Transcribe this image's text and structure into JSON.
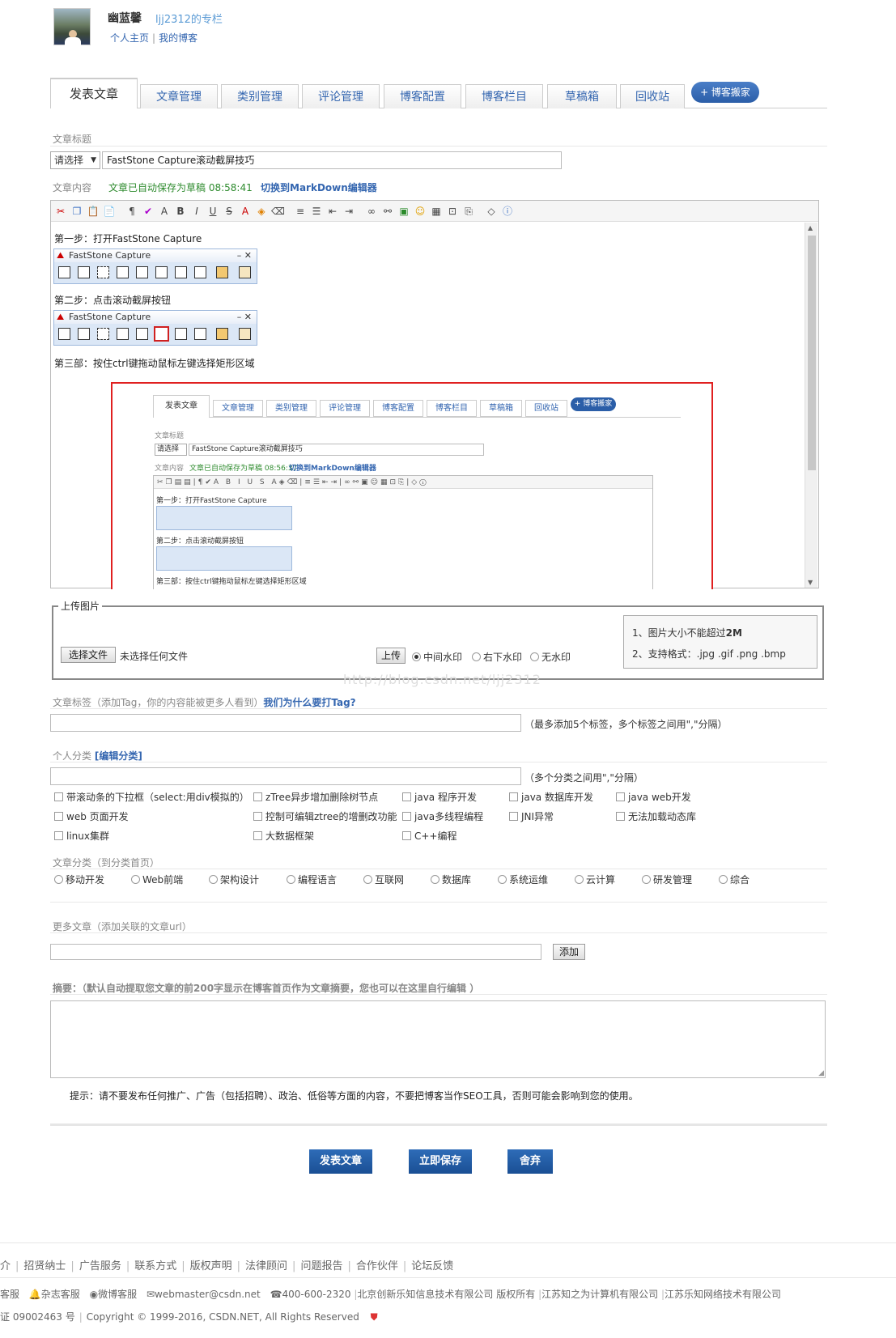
{
  "header": {
    "user_name": "幽蓝馨",
    "column_name": "ljj2312的专栏",
    "home_link": "个人主页",
    "sep": "|",
    "blog_link": "我的博客"
  },
  "tabs": [
    "发表文章",
    "文章管理",
    "类别管理",
    "评论管理",
    "博客配置",
    "博客栏目",
    "草稿箱",
    "回收站"
  ],
  "move_button": "+ 博客搬家",
  "form": {
    "title_label": "文章标题",
    "type_select": "请选择",
    "title_value": "FastStone Capture滚动截屏技巧",
    "content_label": "文章内容",
    "autosave_text": "文章已自动保存为草稿 08:58:41",
    "markdown_link": "切换到MarkDown编辑器"
  },
  "editor": {
    "step1": "第一步：打开FastStone Capture",
    "step2": "第二步：点击滚动截屏按钮",
    "step3": "第三部：按住ctrl键拖动鼠标左键选择矩形区域",
    "fs_title": "FastStone Capture",
    "fs_controls": "–  ✕",
    "fs_logo": "⛰"
  },
  "nested": {
    "tabs": [
      "发表文章",
      "文章管理",
      "类别管理",
      "评论管理",
      "博客配置",
      "博客栏目",
      "草稿箱",
      "回收站"
    ],
    "move_button": "+ 博客搬家",
    "title_label": "文章标题",
    "type_select": "请选择",
    "title_value": "FastStone Capture滚动截屏技巧",
    "content_label": "文章内容",
    "autosave_text": "文章已自动保存为草稿 08:56:37",
    "markdown_link": "切换到MarkDown编辑器",
    "step1": "第一步：打开FastStone Capture",
    "step2": "第二步：点击滚动截屏按钮",
    "step3": "第三部：按住ctrl键拖动鼠标左键选择矩形区域"
  },
  "upload": {
    "legend": "上传图片",
    "choose_file": "选择文件",
    "no_file": "未选择任何文件",
    "upload_btn": "上传",
    "wm_center": "中间水印",
    "wm_bottom_right": "右下水印",
    "wm_none": "无水印",
    "info_line1_prefix": "1、图片大小不能超过",
    "info_line1_bold": "2M",
    "info_line2": "2、支持格式：.jpg .gif .png .bmp",
    "watermark": "http://blog.csdn.net/ljj2312"
  },
  "tags": {
    "label": "文章标签（添加Tag，你的内容能被更多人看到）",
    "why_link": "我们为什么要打Tag?",
    "hint": "（最多添加5个标签，多个标签之间用\",\"分隔）"
  },
  "personal_category": {
    "label": "个人分类",
    "edit_link": "[编辑分类]",
    "hint": "（多个分类之间用\",\"分隔）",
    "items": [
      [
        "带滚动条的下拉框（select:用div模拟的）",
        "zTree异步增加删除树节点",
        "java 程序开发",
        "java 数据库开发",
        "java web开发"
      ],
      [
        "web 页面开发",
        "控制可编辑ztree的增删改功能",
        "java多线程编程",
        "JNI异常",
        "无法加载动态库"
      ],
      [
        "linux集群",
        "大数据框架",
        "C++编程"
      ]
    ]
  },
  "article_category": {
    "label": "文章分类（到分类首页）",
    "items": [
      "移动开发",
      "Web前端",
      "架构设计",
      "编程语言",
      "互联网",
      "数据库",
      "系统运维",
      "云计算",
      "研发管理",
      "综合"
    ]
  },
  "more_articles": {
    "label": "更多文章（添加关联的文章url）",
    "add_btn": "添加"
  },
  "summary": {
    "label": "摘要：（默认自动提取您文章的前200字显示在博客首页作为文章摘要，您也可以在这里自行编辑 ）",
    "notice": "提示：请不要发布任何推广、广告（包括招聘）、政治、低俗等方面的内容，不要把博客当作SEO工具，否则可能会影响到您的使用。"
  },
  "actions": {
    "publish": "发表文章",
    "save": "立即保存",
    "discard": "舍弃"
  },
  "footer": {
    "links": [
      "介",
      "招贤纳士",
      "广告服务",
      "联系方式",
      "版权声明",
      "法律顾问",
      "问题报告",
      "合作伙伴",
      "论坛反馈"
    ],
    "contact": {
      "c1": "客服",
      "c2": "杂志客服",
      "c3": "微博客服",
      "c4": "webmaster@csdn.net",
      "c5": "400-600-2320",
      "c6": "北京创新乐知信息技术有限公司 版权所有",
      "c7": "江苏知之为计算机有限公司",
      "c8": "江苏乐知网络技术有限公司"
    },
    "icp": "证 09002463 号",
    "copyright": "Copyright © 1999-2016, CSDN.NET, All Rights Reserved"
  },
  "colors": {
    "accent": "#3466b0",
    "green": "#2e8b2e",
    "red_frame": "#e02020"
  }
}
